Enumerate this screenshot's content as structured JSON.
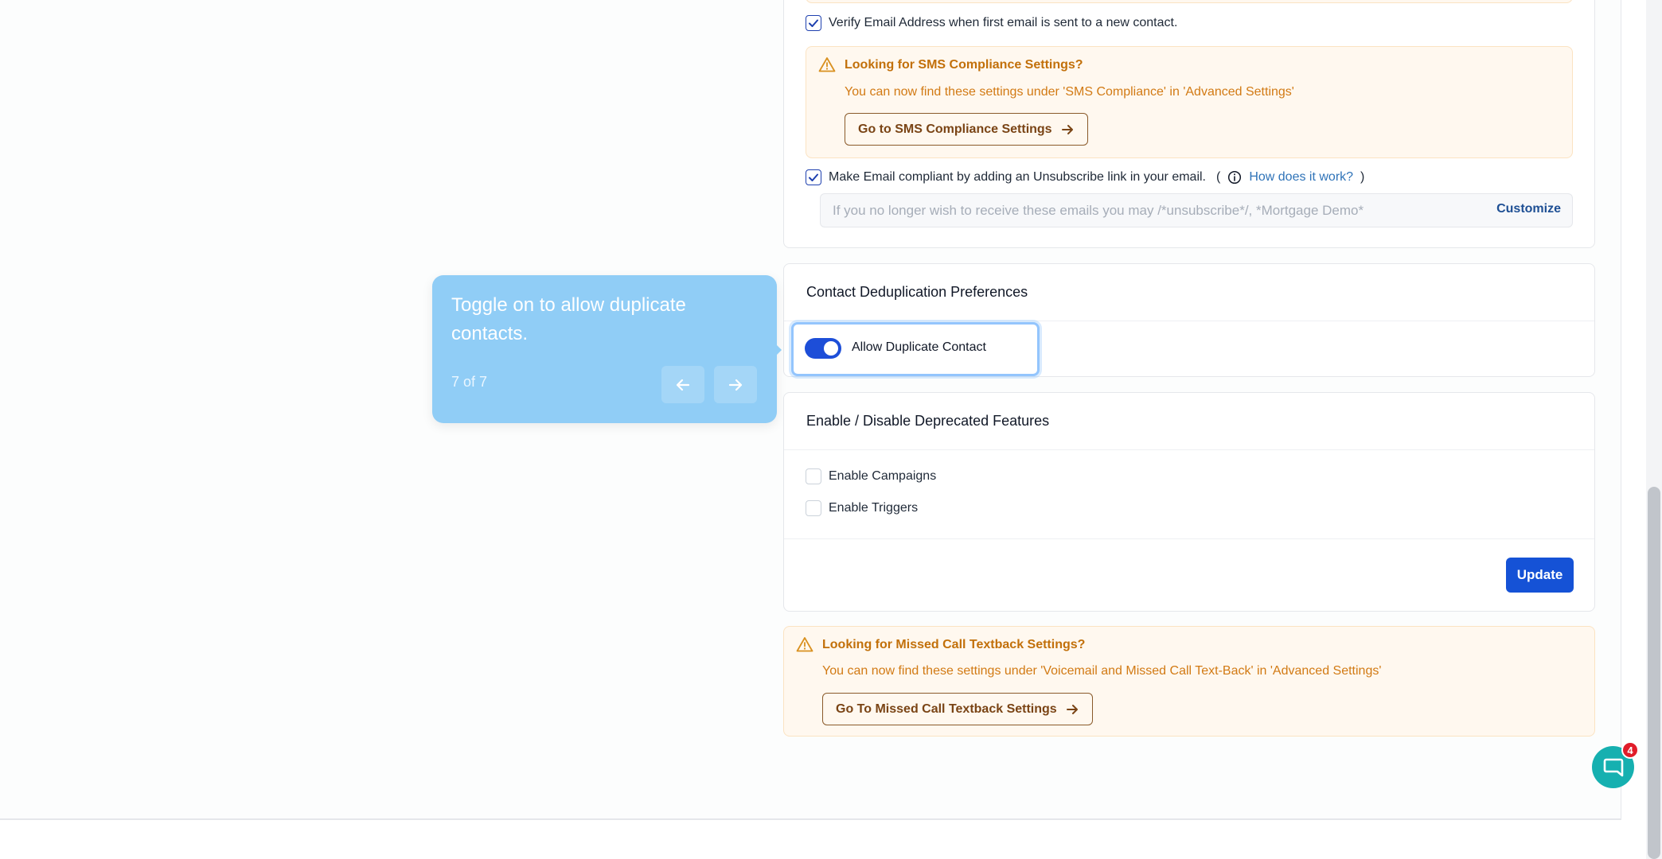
{
  "email_settings": {
    "verify_email_label": "Verify Email Address when first email is sent to a new contact.",
    "sms_notice": {
      "title": "Looking for SMS Compliance Settings?",
      "text": "You can now find these settings under 'SMS Compliance' in 'Advanced Settings'",
      "button_label": "Go to SMS Compliance Settings"
    },
    "unsubscribe_label": "Make Email compliant by adding an Unsubscribe link in your email.",
    "paren_open": "(",
    "how_link": "How does it work?",
    "paren_close": ")",
    "unsubscribe_text": "If you no longer wish to receive these emails you may /*unsubscribe*/, *Mortgage Demo*",
    "customize_label": "Customize"
  },
  "dedup": {
    "title": "Contact Deduplication Preferences",
    "toggle_label": "Allow Duplicate Contact"
  },
  "tooltip": {
    "text": "Toggle on to allow duplicate contacts.",
    "step": "7 of 7"
  },
  "deprecated": {
    "title": "Enable / Disable Deprecated Features",
    "items": [
      {
        "label": "Enable Campaigns"
      },
      {
        "label": "Enable Triggers"
      }
    ],
    "update_label": "Update"
  },
  "missed_call_notice": {
    "title": "Looking for Missed Call Textback Settings?",
    "text": "You can now find these settings under 'Voicemail and Missed Call Text-Back' in 'Advanced Settings'",
    "button_label": "Go To Missed Call Textback Settings"
  },
  "chat": {
    "badge_count": "4"
  },
  "colors": {
    "primary": "#1552d6",
    "warning_text": "#c2700a",
    "tooltip_bg": "#90cdf6",
    "chat": "#16b0b0",
    "badge": "#e11d2a"
  },
  "icons": [
    "check-icon",
    "warning-icon",
    "arrow-right-icon",
    "info-icon",
    "arrow-left-icon",
    "chat-icon"
  ]
}
